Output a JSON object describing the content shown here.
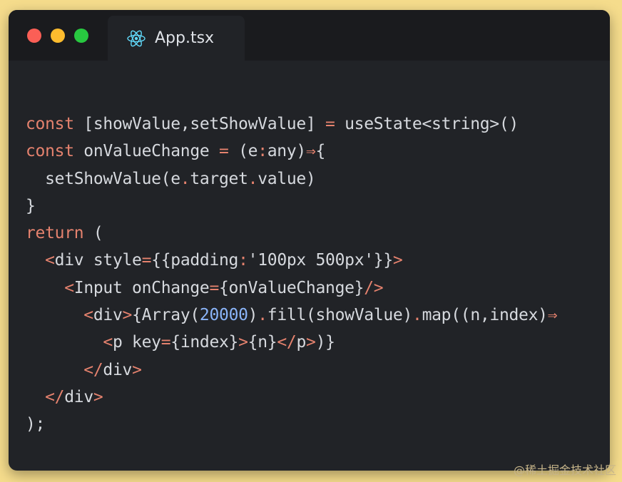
{
  "tab": {
    "title": "App.tsx",
    "icon": "react-icon"
  },
  "window_controls": [
    "close",
    "minimize",
    "maximize"
  ],
  "colors": {
    "background": "#f5dc8c",
    "editor": "#212327",
    "keyword": "#e5826e",
    "number": "#8ab4f8",
    "text": "#d6d9de"
  },
  "code": {
    "lines": [
      [
        [
          "kw",
          "const"
        ],
        [
          "t",
          " [showValue,setShowValue] "
        ],
        [
          "op",
          "="
        ],
        [
          "t",
          " useState<string>()"
        ]
      ],
      [
        [
          "kw",
          "const"
        ],
        [
          "t",
          " onValueChange "
        ],
        [
          "op",
          "="
        ],
        [
          "t",
          " (e"
        ],
        [
          "op",
          ":"
        ],
        [
          "t",
          "any)"
        ],
        [
          "op",
          "⇒"
        ],
        [
          "t",
          "{"
        ]
      ],
      [
        [
          "t",
          "  setShowValue(e"
        ],
        [
          "op",
          "."
        ],
        [
          "t",
          "target"
        ],
        [
          "op",
          "."
        ],
        [
          "t",
          "value)"
        ]
      ],
      [
        [
          "t",
          "}"
        ]
      ],
      [
        [
          "kw",
          "return"
        ],
        [
          "t",
          " ("
        ]
      ],
      [
        [
          "t",
          "  "
        ],
        [
          "op",
          "<"
        ],
        [
          "t",
          "div style"
        ],
        [
          "op",
          "="
        ],
        [
          "t",
          "{{padding"
        ],
        [
          "op",
          ":"
        ],
        [
          "t",
          "'100px 500px'}}"
        ],
        [
          "op",
          ">"
        ]
      ],
      [
        [
          "t",
          "    "
        ],
        [
          "op",
          "<"
        ],
        [
          "t",
          "Input onChange"
        ],
        [
          "op",
          "="
        ],
        [
          "t",
          "{onValueChange}"
        ],
        [
          "op",
          "/>"
        ]
      ],
      [
        [
          "t",
          "      "
        ],
        [
          "op",
          "<"
        ],
        [
          "t",
          "div"
        ],
        [
          "op",
          ">"
        ],
        [
          "t",
          "{Array("
        ],
        [
          "num",
          "20000"
        ],
        [
          "t",
          ")"
        ],
        [
          "op",
          "."
        ],
        [
          "t",
          "fill(showValue)"
        ],
        [
          "op",
          "."
        ],
        [
          "t",
          "map((n,index)"
        ],
        [
          "op",
          "⇒"
        ]
      ],
      [
        [
          "t",
          "        "
        ],
        [
          "op",
          "<"
        ],
        [
          "t",
          "p key"
        ],
        [
          "op",
          "="
        ],
        [
          "t",
          "{index}"
        ],
        [
          "op",
          ">"
        ],
        [
          "t",
          "{n}"
        ],
        [
          "op",
          "</"
        ],
        [
          "t",
          "p"
        ],
        [
          "op",
          ">"
        ],
        [
          "t",
          ")}"
        ]
      ],
      [
        [
          "t",
          "      "
        ],
        [
          "op",
          "</"
        ],
        [
          "t",
          "div"
        ],
        [
          "op",
          ">"
        ]
      ],
      [
        [
          "t",
          "  "
        ],
        [
          "op",
          "</"
        ],
        [
          "t",
          "div"
        ],
        [
          "op",
          ">"
        ]
      ],
      [
        [
          "t",
          ");"
        ]
      ]
    ]
  },
  "watermark": "@稀土掘金技术社区"
}
